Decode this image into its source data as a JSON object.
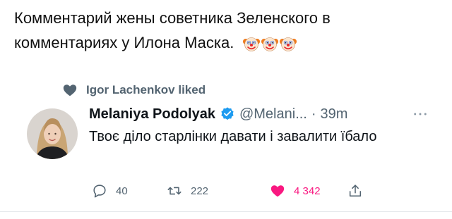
{
  "caption": {
    "text": "Комментарий жены советника Зеленского в комментариях у Илона Маска.",
    "emoji_icons": [
      "clown-face-icon",
      "clown-face-icon",
      "clown-face-icon"
    ]
  },
  "tweet": {
    "social_context": "Igor Lachenkov liked",
    "author": {
      "name": "Melaniya Podolyak",
      "handle": "@Melani...",
      "verified": true
    },
    "separator": "·",
    "time": "39m",
    "text": "Твоє діло старлінки давати і завалити їбало",
    "stats": {
      "replies": "40",
      "retweets": "222",
      "likes": "4 342"
    }
  },
  "colors": {
    "text_primary": "#0f1419",
    "text_secondary": "#536471",
    "verified_blue": "#1d9bf0",
    "like_pink": "#f91880"
  }
}
